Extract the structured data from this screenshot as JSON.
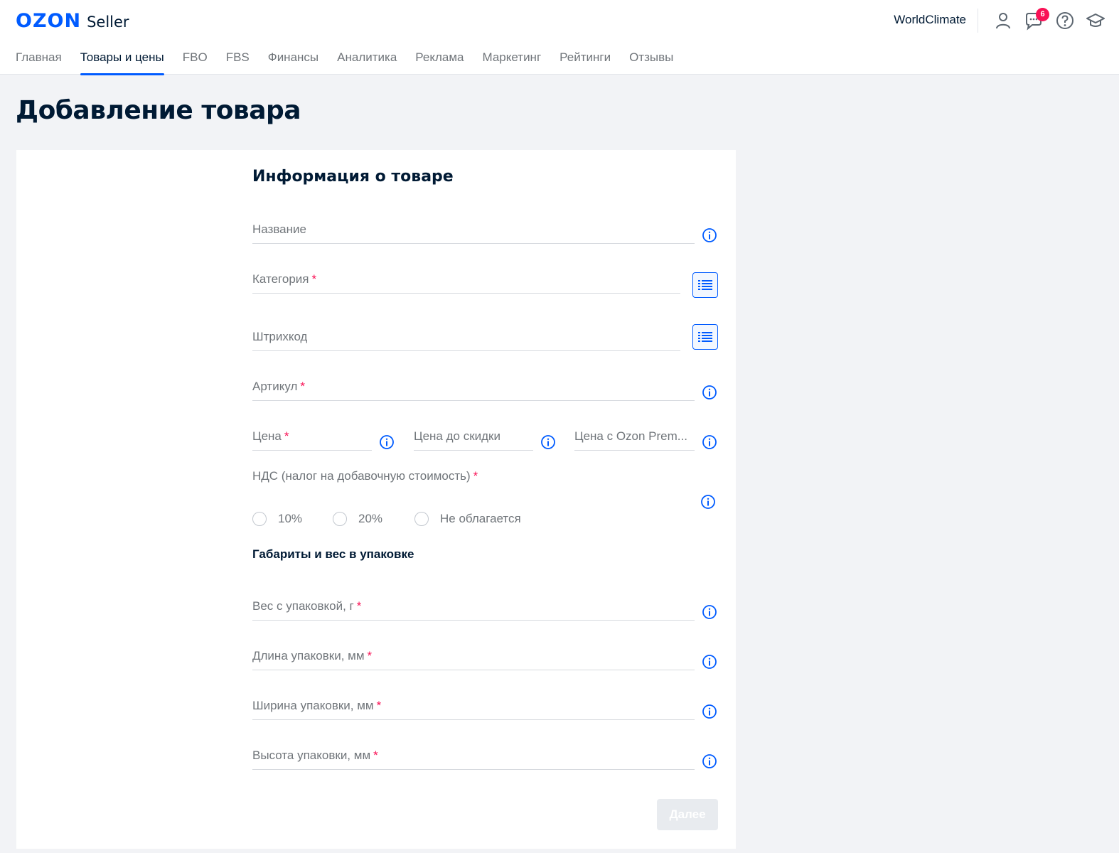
{
  "header": {
    "logo_brand": "OZON",
    "logo_product": "Seller",
    "company": "WorldClimate",
    "notifications_count": "6",
    "nav": [
      {
        "label": "Главная",
        "active": false
      },
      {
        "label": "Товары и цены",
        "active": true
      },
      {
        "label": "FBO",
        "active": false
      },
      {
        "label": "FBS",
        "active": false
      },
      {
        "label": "Финансы",
        "active": false
      },
      {
        "label": "Аналитика",
        "active": false
      },
      {
        "label": "Реклама",
        "active": false
      },
      {
        "label": "Маркетинг",
        "active": false
      },
      {
        "label": "Рейтинги",
        "active": false
      },
      {
        "label": "Отзывы",
        "active": false
      }
    ],
    "icons": [
      "user-icon",
      "chat-icon",
      "help-icon",
      "education-icon"
    ]
  },
  "page_title": "Добавление товара",
  "form": {
    "section_title": "Информация о товаре",
    "fields": {
      "name": {
        "label": "Название",
        "required": false
      },
      "category": {
        "label": "Категория",
        "required": true
      },
      "barcode": {
        "label": "Штрихкод",
        "required": false
      },
      "article": {
        "label": "Артикул",
        "required": true
      },
      "price": {
        "label": "Цена",
        "required": true
      },
      "old_price": {
        "label": "Цена до скидки",
        "required": false
      },
      "premium_price": {
        "label": "Цена с Ozon Prem...",
        "required": false
      }
    },
    "vat": {
      "label": "НДС (налог на добавочную стоимость)",
      "required": true,
      "options": [
        "10%",
        "20%",
        "Не облагается"
      ]
    },
    "dimensions_title": "Габариты и вес в упаковке",
    "dimensions": {
      "weight": {
        "label": "Вес с упаковкой, г",
        "required": true
      },
      "length": {
        "label": "Длина упаковки, мм",
        "required": true
      },
      "width": {
        "label": "Ширина упаковки, мм",
        "required": true
      },
      "height": {
        "label": "Высота упаковки, мм",
        "required": true
      }
    },
    "required_mark": "*",
    "submit_label": "Далее"
  },
  "colors": {
    "accent": "#005bff",
    "required": "#f91155",
    "text": "#001a34",
    "muted": "#70757a"
  }
}
